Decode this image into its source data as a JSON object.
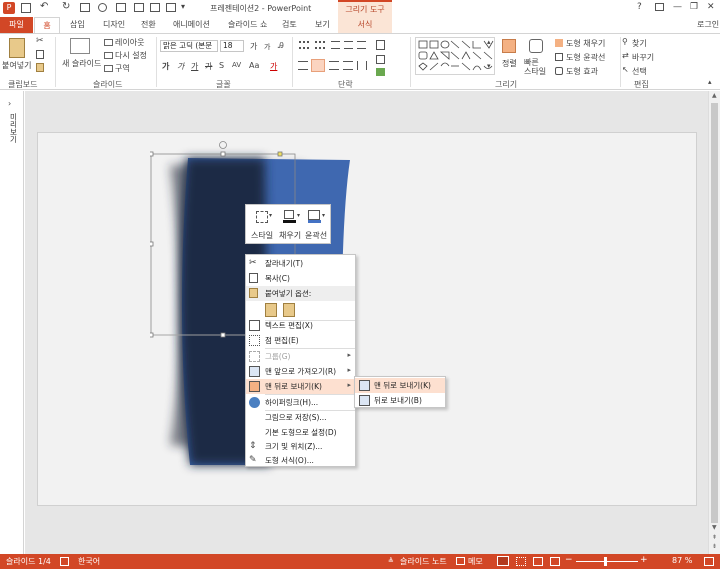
{
  "titlebar": {
    "title": "프레젠테이션2 - PowerPoint",
    "context_tool": "그리기 도구",
    "help": "?",
    "minimize": "—",
    "restore": "❐",
    "close": "✕"
  },
  "tabs": {
    "file": "파일",
    "home": "홈",
    "insert": "삽입",
    "design": "디자인",
    "transitions": "전환",
    "animations": "애니메이션",
    "slideshow": "슬라이드 쇼",
    "review": "검토",
    "view": "보기",
    "format": "서식",
    "signin": "로그인"
  },
  "ribbon": {
    "clipboard": {
      "paste": "붙여넣기",
      "label": "클립보드"
    },
    "slides": {
      "new_slide": "새 슬라이드",
      "layout": "레이아웃",
      "reset": "다시 설정",
      "section": "구역",
      "label": "슬라이드"
    },
    "font": {
      "font_name": "맑은 고딕 (본문",
      "font_size": "18",
      "grow": "가",
      "shrink": "가",
      "clear": "Ꭿ",
      "bold": "가",
      "italic": "가",
      "underline": "가",
      "strike": "가",
      "shadow": "S",
      "spacing": "AV",
      "case": "Aa",
      "color": "가",
      "label": "글꼴"
    },
    "paragraph": {
      "label": "단락"
    },
    "drawing": {
      "arrange": "정렬",
      "quick_styles": "빠른\n스타일",
      "fill": "도형 채우기",
      "outline": "도형 윤곽선",
      "effects": "도형 효과",
      "label": "그리기"
    },
    "editing": {
      "find": "찾기",
      "replace": "바꾸기",
      "select": "선택",
      "label": "편집"
    }
  },
  "thumbpane": {
    "label": "미리보기"
  },
  "minitoolbar": {
    "style": "스타일",
    "fill": "채우기",
    "outline": "윤곽선"
  },
  "contextmenu": {
    "items": [
      {
        "label": "잘라내기(T)",
        "disabled": false
      },
      {
        "label": "복사(C)",
        "disabled": false
      },
      {
        "label": "붙여넣기 옵션:",
        "disabled": false
      },
      {
        "label": "텍스트 편집(X)",
        "disabled": false
      },
      {
        "label": "점 편집(E)",
        "disabled": false
      },
      {
        "label": "그룹(G)",
        "disabled": true
      },
      {
        "label": "맨 앞으로 가져오기(R)",
        "disabled": false
      },
      {
        "label": "맨 뒤로 보내기(K)",
        "disabled": false
      },
      {
        "label": "하이퍼링크(H)...",
        "disabled": false
      },
      {
        "label": "그림으로 저장(S)...",
        "disabled": false
      },
      {
        "label": "기본 도형으로 설정(D)",
        "disabled": false
      },
      {
        "label": "크기 및 위치(Z)...",
        "disabled": false
      },
      {
        "label": "도형 서식(O)...",
        "disabled": false
      }
    ],
    "submenu": [
      {
        "label": "맨 뒤로 보내기(K)"
      },
      {
        "label": "뒤로 보내기(B)"
      }
    ]
  },
  "statusbar": {
    "slide": "슬라이드 1/4",
    "language": "한국어",
    "notes": "슬라이드 노트",
    "comments": "메모",
    "zoom": "87 %"
  },
  "colors": {
    "accent": "#d24726",
    "shape_blue": "#3f68b0",
    "shape_dark": "#1a2a45"
  }
}
